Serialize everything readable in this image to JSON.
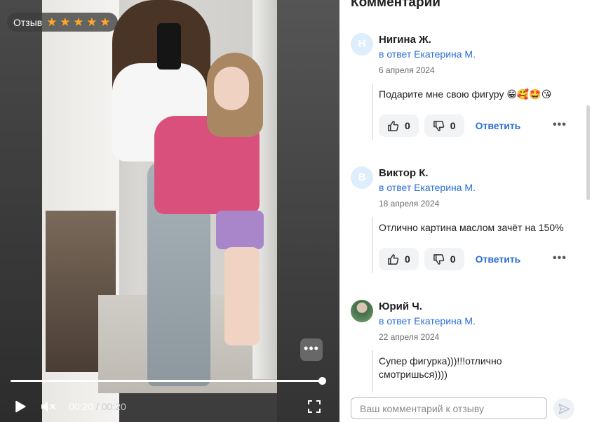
{
  "video": {
    "badge_label": "Отзыв",
    "rating": 5,
    "rating_max": 5,
    "progress": 1.0,
    "current_time": "00:20",
    "separator": " / ",
    "duration": "00:20",
    "more_label": "•••"
  },
  "panel": {
    "title": "Комментарии"
  },
  "comments": [
    {
      "avatar_letter": "Н",
      "author": "Нигина Ж.",
      "reply_to": "в ответ Екатерина М.",
      "date": "6 апреля 2024",
      "text": "Подарите мне свою фигуру 😁🥰🤩😘",
      "likes": "0",
      "dislikes": "0",
      "answer_label": "Ответить",
      "more_label": "•••"
    },
    {
      "avatar_letter": "В",
      "author": "Виктор К.",
      "reply_to": "в ответ Екатерина М.",
      "date": "18 апреля 2024",
      "text": "Отлично картина маслом зачёт на 150%",
      "likes": "0",
      "dislikes": "0",
      "answer_label": "Ответить",
      "more_label": "•••"
    },
    {
      "avatar_letter": "",
      "author": "Юрий Ч.",
      "reply_to": "в ответ Екатерина М.",
      "date": "22 апреля 2024",
      "text": "Супер фигурка)))!!!отлично смотришься))))"
    }
  ],
  "composer": {
    "placeholder": "Ваш комментарий к отзыву"
  },
  "colors": {
    "link": "#2b6ed6",
    "star": "#ffa726"
  }
}
